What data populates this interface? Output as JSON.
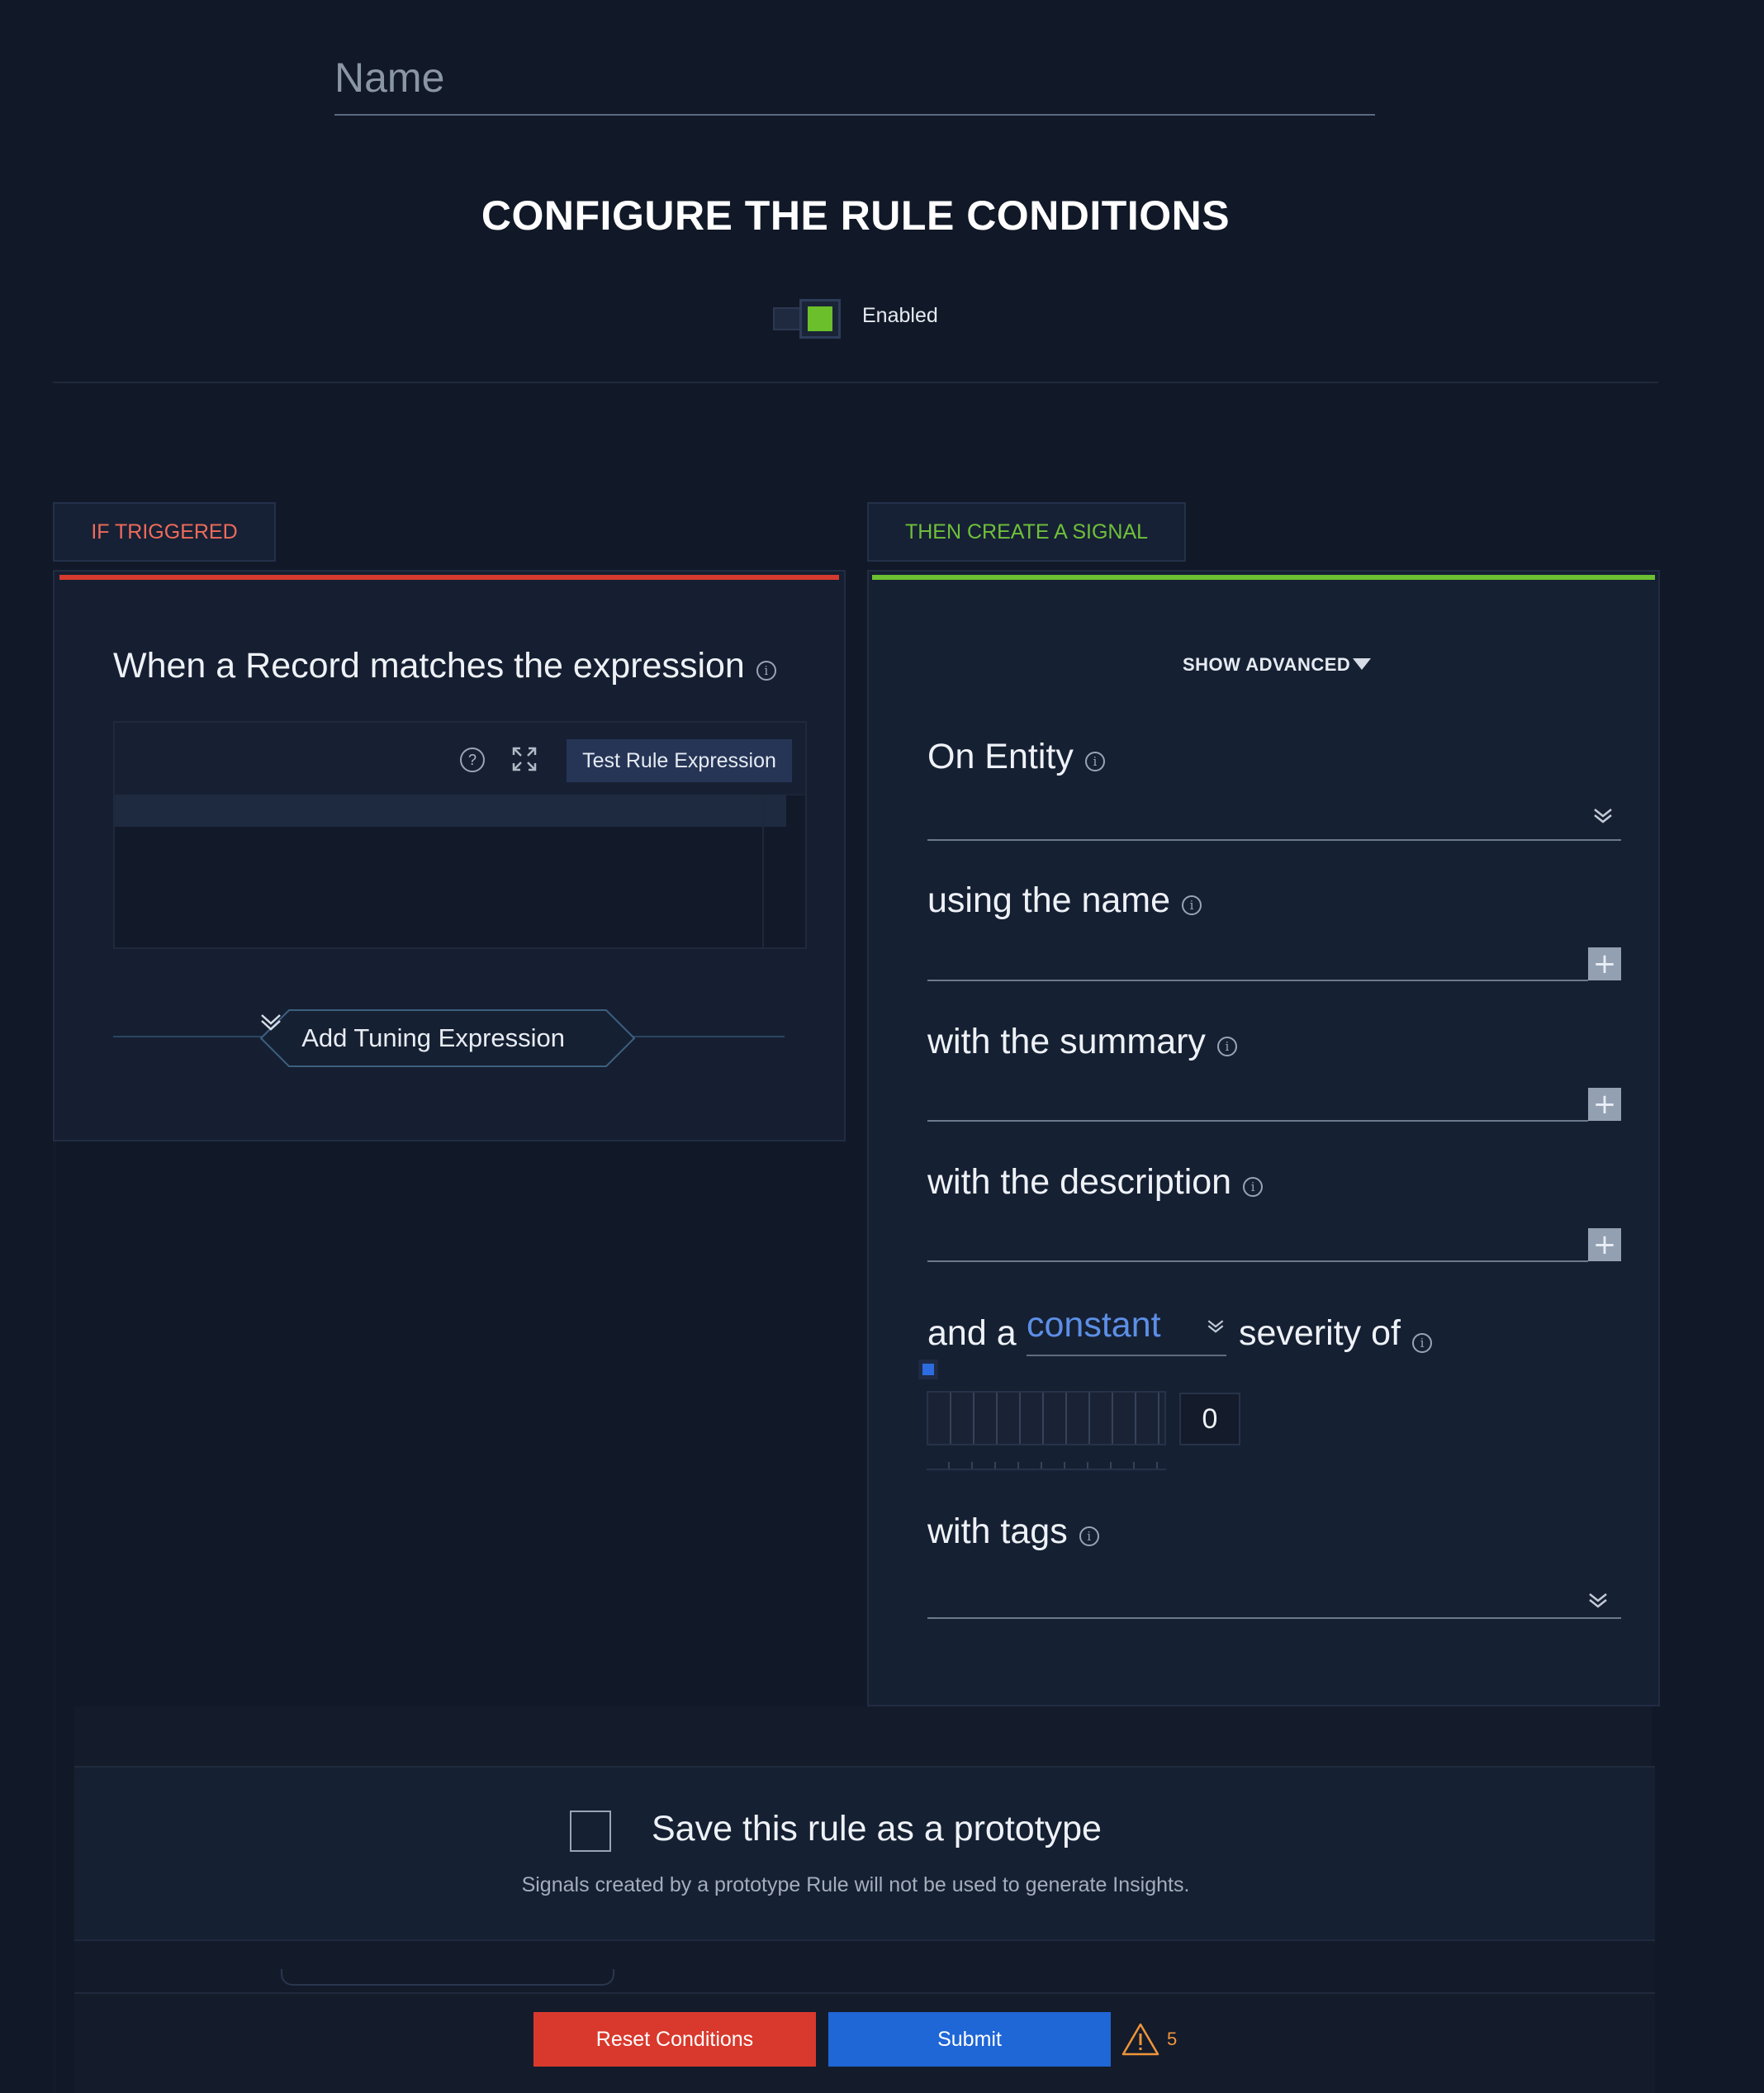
{
  "name_field": {
    "placeholder": "Name",
    "value": ""
  },
  "page_title": "CONFIGURE THE RULE CONDITIONS",
  "enabled_toggle": {
    "label": "Enabled",
    "on": true
  },
  "tabs": {
    "if_triggered": "IF TRIGGERED",
    "then_create_signal": "THEN CREATE A SIGNAL"
  },
  "left_panel": {
    "expression_title": "When a Record matches the expression",
    "help_icon": "question-circle-icon",
    "expand_icon": "expand-icon",
    "test_button": "Test Rule Expression",
    "editor_value": "",
    "tuning_button": "Add Tuning Expression"
  },
  "right_panel": {
    "show_advanced": "SHOW ADVANCED",
    "on_entity": {
      "label": "On Entity",
      "value": ""
    },
    "using_name": {
      "label": "using the name",
      "value": ""
    },
    "with_summary": {
      "label": "with the summary",
      "value": ""
    },
    "with_description": {
      "label": "with the description",
      "value": ""
    },
    "severity": {
      "prefix": "and a",
      "mode": "constant",
      "suffix": "severity of",
      "value": "0"
    },
    "with_tags": {
      "label": "with tags",
      "value": ""
    }
  },
  "prototype": {
    "checked": false,
    "label": "Save this rule as a prototype",
    "hint": "Signals created by a prototype Rule will not be used to generate Insights."
  },
  "footer": {
    "reset_label": "Reset Conditions",
    "submit_label": "Submit",
    "warning_count": "5",
    "warning_icon": "warning-triangle-icon"
  },
  "colors": {
    "background": "#111827",
    "panel": "#162033",
    "if_accent": "#d63a2f",
    "then_accent": "#6cc031",
    "toggle_on": "#6bbf2a",
    "link_blue": "#5c8fe6",
    "submit_blue": "#1f66d6",
    "reset_red": "#d9392d",
    "warning_orange": "#f0953a"
  }
}
